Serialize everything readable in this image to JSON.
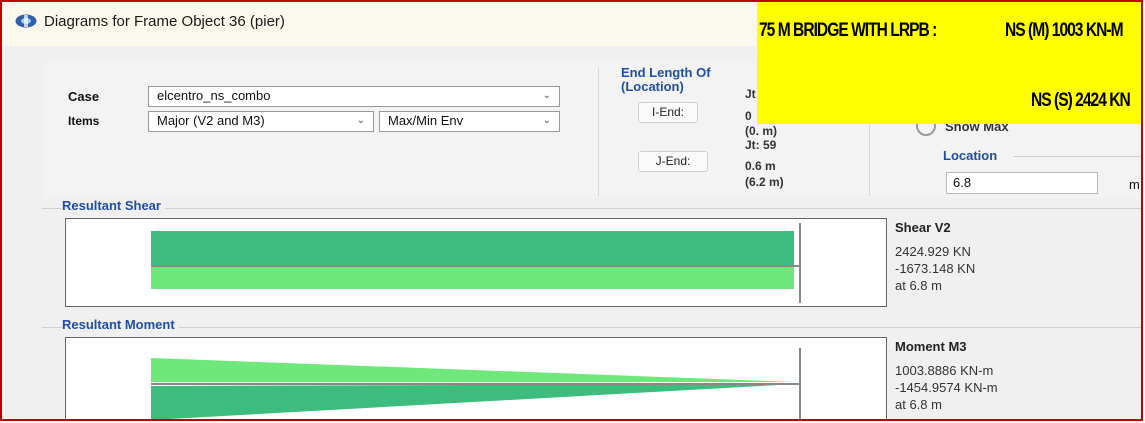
{
  "window": {
    "title": "Diagrams for Frame Object 36  (pier)"
  },
  "banner": {
    "line1_left": "75 M BRIDGE WITH LRPB :",
    "line1_right": "NS (M)   1003 KN-M",
    "line2": "NS (S)   2424 KN"
  },
  "case": {
    "label": "Case",
    "value": "elcentro_ns_combo"
  },
  "items": {
    "label": "Items",
    "value": "Major (V2 and M3)",
    "env": "Max/Min Env"
  },
  "end_length": {
    "title": "End Length Of",
    "subtitle": "(Location)",
    "i_end_label": "I-End:",
    "i_jt": "Jt",
    "i_value": "0",
    "i_location": "(0. m)",
    "j_end_label": "J-End:",
    "j_jt": "Jt:  59",
    "j_value": "0.6 m",
    "j_location": "(6.2 m)"
  },
  "show_max_label": "Show Max",
  "location": {
    "title": "Location",
    "value": "6.8",
    "unit": "m"
  },
  "shear": {
    "section_title": "Resultant Shear",
    "title": "Shear V2",
    "max": "2424.929 KN",
    "min": "-1673.148 KN",
    "at": "at 6.8 m"
  },
  "moment": {
    "section_title": "Resultant Moment",
    "title": "Moment M3",
    "max": "1003.8886 KN-m",
    "min": "-1454.9574 KN-m",
    "at": "at 6.8 m"
  },
  "colors": {
    "positive": "#3dbd7d",
    "negative": "#6ee87a",
    "accent": "#1f4ea5",
    "banner": "#ffff00"
  },
  "icons": {
    "app": "app-logo-icon",
    "dropdown": "chevron-down-icon"
  }
}
